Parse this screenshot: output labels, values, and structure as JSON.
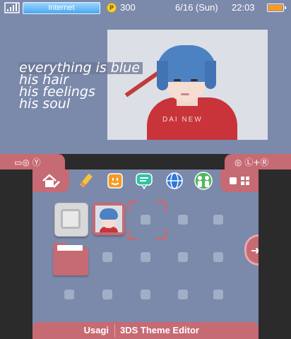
{
  "status": {
    "connection": "Internet",
    "coins": "300",
    "date": "6/16 (Sun)",
    "time": "22:03",
    "icons": [
      "signal-icon",
      "coin-icon",
      "battery-icon"
    ]
  },
  "top_screen": {
    "lyrics": [
      "everything is blue",
      "his hair",
      "his feelings",
      "his soul"
    ],
    "photo_shirt_text": "DAI NEW"
  },
  "tabs": {
    "left_glyph": "▭◎ Ⓨ",
    "right_glyph": "◎ Ⓛ+Ⓡ"
  },
  "toolbar": {
    "items": [
      "home-settings-icon",
      "pencil-icon",
      "smiley-icon",
      "chat-icon",
      "globe-icon",
      "friends-icon"
    ]
  },
  "bottom_bar": {
    "author": "Usagi",
    "title": "3DS Theme Editor"
  },
  "colors": {
    "background": "#7b89ab",
    "accent": "#c66a73",
    "slot": "#a2aec6"
  }
}
